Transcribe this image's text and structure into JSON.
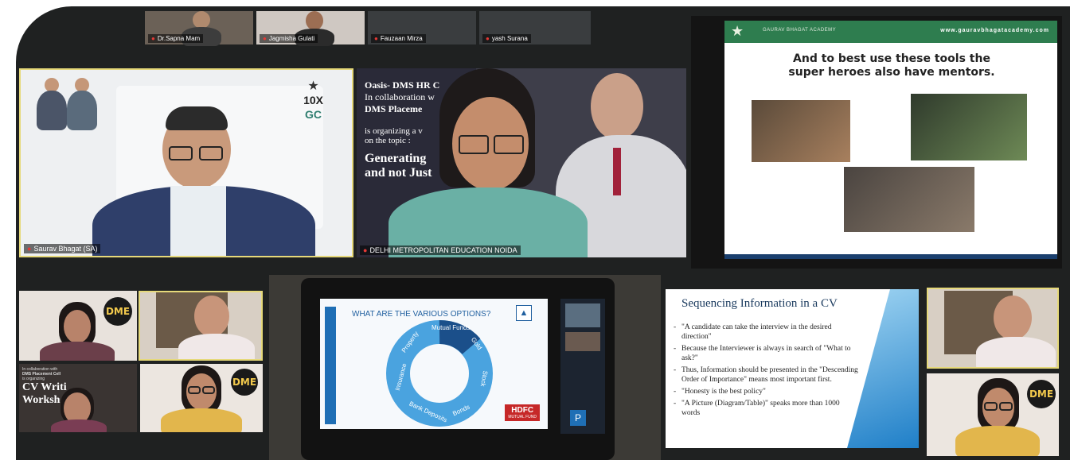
{
  "top_strip": {
    "participants": [
      {
        "name": "Dr.Sapna Mam"
      },
      {
        "name": "Jagmisha Gulati"
      },
      {
        "name": "Fauzaan Mirza"
      },
      {
        "name": "yash Surana"
      }
    ]
  },
  "speaker_tile": {
    "logo_text": "10X",
    "logo_abbr": "GC",
    "name_tag": "Saurav Bhagat (SA)"
  },
  "host_tile": {
    "banner_lines": [
      "Oasis- DMS HR C",
      "In collaboration w",
      "DMS Placeme",
      "is organizing a v",
      "on the topic :",
      "Generating",
      "and not Just"
    ],
    "name_tag": "DELHI METROPOLITAN EDUCATION NOIDA"
  },
  "mentor_slide": {
    "brand": "GAURAV BHAGAT ACADEMY",
    "url": "www.gauravbhagatacademy.com",
    "heading": "And to best use these tools the super heroes also have mentors."
  },
  "grid_left": {
    "badge": "DME",
    "poster_lines": [
      "In collaboration with",
      "DMS Placement Cell",
      "is organizing",
      "CV Writi",
      "Worksh"
    ]
  },
  "options_slide": {
    "title": "WHAT ARE THE VARIOUS OPTIONS?",
    "segments": [
      "Mutual Funds",
      "Gold",
      "Stock",
      "Bonds",
      "Bank Deposits",
      "Insurance",
      "Property"
    ],
    "brand": "HDFC",
    "brand_sub": "MUTUAL FUND",
    "side_initial": "P"
  },
  "cv_slide": {
    "title": "Sequencing Information in a CV",
    "bullets": [
      "\"A candidate can take the interview in the desired direction\"",
      "Because the Interviewer is always in search of \"What to ask?\"",
      "Thus, Information should be presented in the \"Descending Order of Importance\" means most important first.",
      "\"Honesty is the best policy\"",
      "\"A Picture (Diagram/Table)\" speaks more than 1000 words"
    ]
  },
  "colors": {
    "frame": "#1f2121",
    "active_speaker_border": "#e6d97a",
    "slide_blue": "#1f6fb5",
    "dme_gold": "#f2c94c",
    "mentor_header": "#2e7d4f"
  }
}
